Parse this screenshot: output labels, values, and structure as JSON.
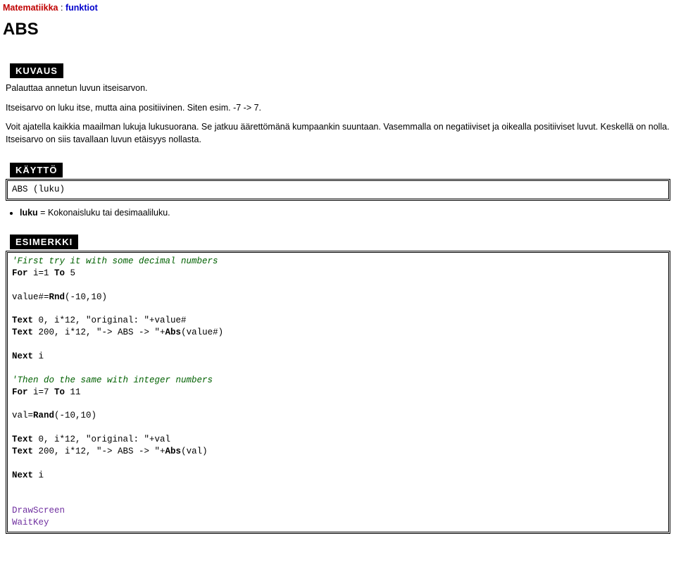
{
  "breadcrumb": {
    "category": "Matematiikka",
    "sep": " : ",
    "sub": "funktiot"
  },
  "title": "ABS",
  "sections": {
    "kuvaus": {
      "head": "KUVAUS",
      "p1": "Palauttaa annetun luvun itseisarvon.",
      "p2": "Itseisarvo on luku itse, mutta aina positiivinen. Siten esim. -7 -> 7.",
      "p3": "Voit ajatella kaikkia maailman lukuja lukusuorana. Se jatkuu äärettömänä kumpaankin suuntaan. Vasemmalla on negatiiviset ja oikealla positiiviset luvut. Keskellä on nolla. Itseisarvo on siis tavallaan luvun etäisyys nollasta."
    },
    "kaytto": {
      "head": "KÄYTTÖ",
      "syntax": "ABS (luku)",
      "param_name": "luku",
      "param_desc": " = Kokonaisluku tai desimaaliluku."
    },
    "esimerkki": {
      "head": "ESIMERKKI",
      "c1": "'First try it with some decimal numbers",
      "l2a": "For",
      "l2b": " i=1 ",
      "l2c": "To",
      "l2d": " 5",
      "l3a": "value#=",
      "l3b": "Rnd",
      "l3c": "(-10,10)",
      "l4a": "Text",
      "l4b": " 0, i*12, \"original: \"+value#",
      "l5a": "Text",
      "l5b": " 200, i*12, \"-> ABS -> \"+",
      "l5c": "Abs",
      "l5d": "(value#)",
      "l6a": "Next",
      "l6b": " i",
      "c2": "'Then do the same with integer numbers",
      "l7a": "For",
      "l7b": " i=7 ",
      "l7c": "To",
      "l7d": " 11",
      "l8a": "val=",
      "l8b": "Rand",
      "l8c": "(-10,10)",
      "l9a": "Text",
      "l9b": " 0, i*12, \"original: \"+val",
      "l10a": "Text",
      "l10b": " 200, i*12, \"-> ABS -> \"+",
      "l10c": "Abs",
      "l10d": "(val)",
      "l11a": "Next",
      "l11b": " i",
      "api1": "DrawScreen",
      "api2": "WaitKey"
    }
  }
}
